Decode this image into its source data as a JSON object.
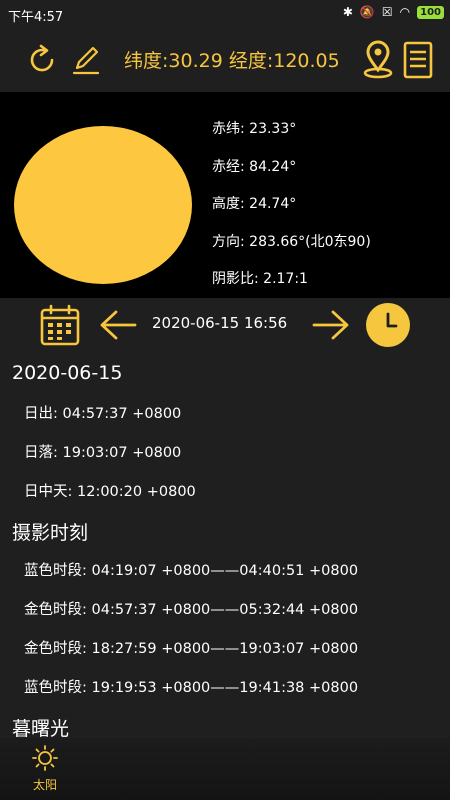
{
  "status_bar": {
    "time": "下午4:57",
    "battery": "100"
  },
  "toolbar": {
    "coordinates": "纬度:30.29 经度:120.05"
  },
  "sun_info": {
    "declination": "赤纬: 23.33°",
    "right_ascension": "赤经: 84.24°",
    "altitude": "高度: 24.74°",
    "azimuth": "方向: 283.66°(北0东90)",
    "shadow_ratio": "阴影比: 2.17:1"
  },
  "date_nav": {
    "datetime": "2020-06-15 16:56"
  },
  "sections": {
    "date_heading": "2020-06-15",
    "sunrise": "日出: 04:57:37 +0800",
    "sunset": "日落: 19:03:07 +0800",
    "solar_noon": "日中天: 12:00:20 +0800",
    "photo_heading": "摄影时刻",
    "blue_hour_morning": "蓝色时段: 04:19:07 +0800——04:40:51 +0800",
    "golden_hour_morning": "金色时段: 04:57:37 +0800——05:32:44 +0800",
    "golden_hour_evening": "金色时段: 18:27:59 +0800——19:03:07 +0800",
    "blue_hour_evening": "蓝色时段: 19:19:53 +0800——19:41:38 +0800",
    "twilight_heading": "暮曙光"
  },
  "tab_bar": {
    "sun_tab_label": "太阳"
  },
  "colors": {
    "accent": "#f6c63e",
    "sun": "#fdc83f",
    "background": "#1f1f1f",
    "panel": "#000000"
  }
}
